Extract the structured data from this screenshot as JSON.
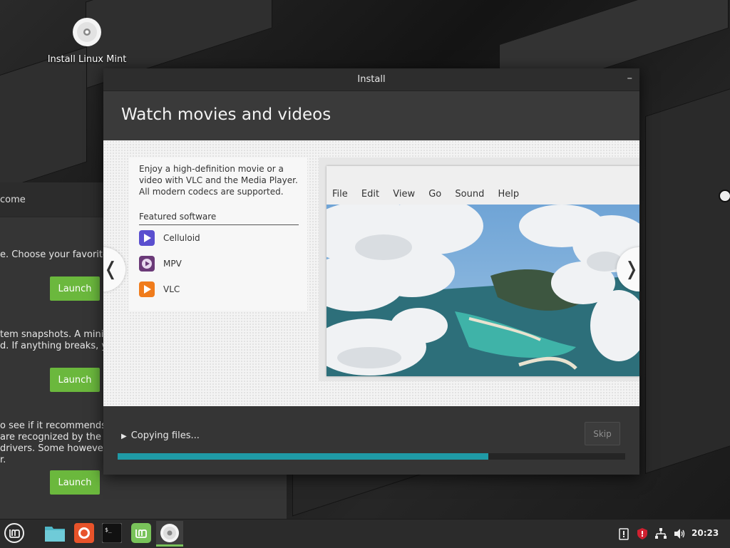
{
  "desktop": {
    "icon_label": "Install Linux Mint"
  },
  "welcome_window": {
    "title_partial": "come",
    "lines": [
      "e. Choose your favorite c",
      "tem snapshots. A minimu",
      "d. If anything breaks, you",
      "o see if it recommends ar",
      " are recognized by the L",
      "drivers. Some however re",
      "r."
    ],
    "launch_label": "Launch"
  },
  "install_window": {
    "title": "Install",
    "minimize_glyph": "–",
    "heading": "Watch movies and videos",
    "slide": {
      "description": "Enjoy a high-definition movie or a video with VLC and the Media Player. All modern codecs are supported.",
      "featured_label": "Featured software",
      "apps": [
        {
          "name": "Celluloid",
          "icon": "celluloid-icon"
        },
        {
          "name": "MPV",
          "icon": "mpv-icon"
        },
        {
          "name": "VLC",
          "icon": "vlc-icon"
        }
      ],
      "menu": [
        "File",
        "Edit",
        "View",
        "Go",
        "Sound",
        "Help"
      ],
      "prev_glyph": "❬",
      "next_glyph": "❭"
    },
    "status": "Copying files...",
    "skip_label": "Skip",
    "progress": 0.73
  },
  "taskbar": {
    "clock": "20:23",
    "items": [
      "menu-icon",
      "files-icon",
      "firefox-icon",
      "terminal-icon",
      "mint-welcome-icon",
      "installer-icon"
    ]
  },
  "colors": {
    "accent": "#1f9aa6",
    "launch": "#6bb83d",
    "mint": "#79c35a"
  }
}
